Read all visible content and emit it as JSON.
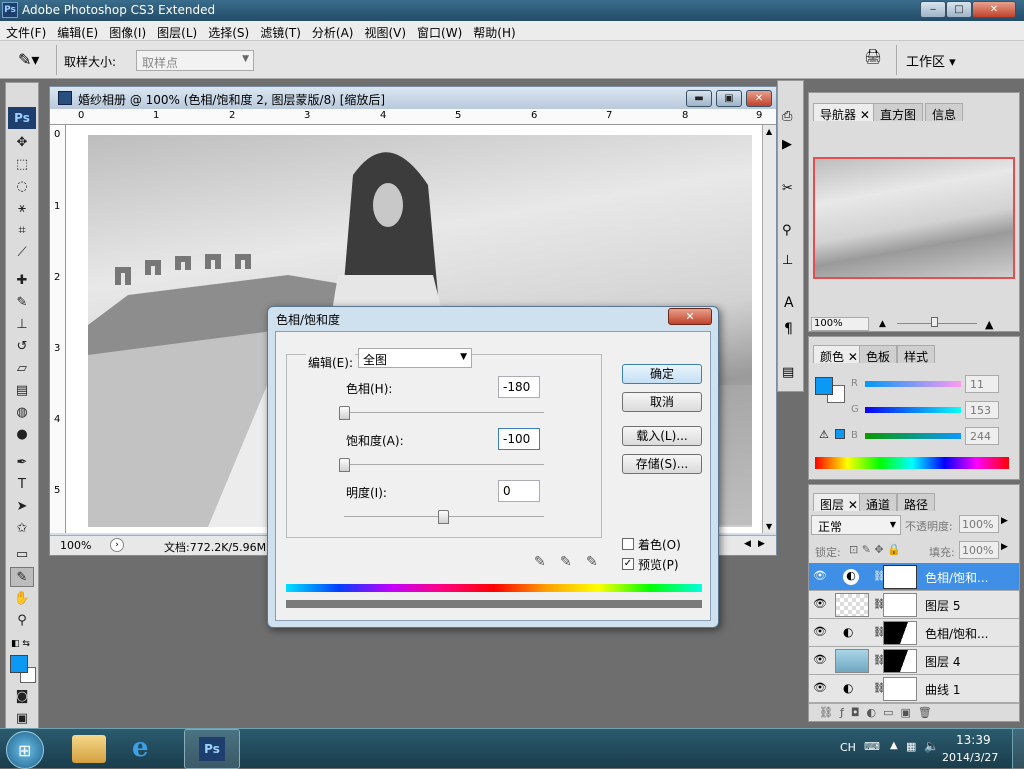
{
  "window": {
    "title": "Adobe Photoshop CS3 Extended",
    "app_icon": "Ps",
    "min": "‒",
    "max": "□",
    "close": "✕"
  },
  "menu": [
    "文件(F)",
    "编辑(E)",
    "图像(I)",
    "图层(L)",
    "选择(S)",
    "滤镜(T)",
    "分析(A)",
    "视图(V)",
    "窗口(W)",
    "帮助(H)"
  ],
  "options": {
    "sample_size_label": "取样大小:",
    "sample_size_value": "取样点",
    "workspace_label": "工作区 ▾"
  },
  "document": {
    "title": "婚纱相册 @ 100% (色相/饱和度 2, 图层蒙版/8) [缩放后]",
    "ruler_top": [
      "0",
      "1",
      "2",
      "3",
      "4",
      "5",
      "6",
      "7",
      "8",
      "9"
    ],
    "ruler_left": [
      "0",
      "1",
      "2",
      "3",
      "4",
      "5"
    ],
    "zoom": "100%",
    "doc_info": "文档:772.2K/5.96M"
  },
  "dialog": {
    "title": "色相/饱和度",
    "edit_label": "编辑(E):",
    "edit_value": "全图",
    "hue_label": "色相(H):",
    "hue_value": "-180",
    "sat_label": "饱和度(A):",
    "sat_value": "-100",
    "light_label": "明度(I):",
    "light_value": "0",
    "ok": "确定",
    "cancel": "取消",
    "load": "载入(L)...",
    "save": "存储(S)...",
    "colorize": "着色(O)",
    "preview": "预览(P)",
    "colorize_checked": false,
    "preview_checked": true
  },
  "navigator": {
    "tabs": [
      "导航器",
      "直方图",
      "信息"
    ],
    "zoom": "100%"
  },
  "color_panel": {
    "tabs": [
      "颜色",
      "色板",
      "样式"
    ],
    "r_label": "R",
    "r_value": "11",
    "g_label": "G",
    "g_value": "153",
    "b_label": "B",
    "b_value": "244",
    "foreground": "#0b99f4"
  },
  "layers_panel": {
    "tabs": [
      "图层",
      "通道",
      "路径"
    ],
    "blend_mode": "正常",
    "opacity_label": "不透明度:",
    "opacity_value": "100%",
    "lock_label": "锁定:",
    "fill_label": "填充:",
    "fill_value": "100%",
    "layers": [
      {
        "name": "色相/饱和...",
        "type": "adjustment",
        "selected": true
      },
      {
        "name": "图层 5",
        "type": "pixel",
        "selected": false
      },
      {
        "name": "色相/饱和...",
        "type": "adjustment",
        "selected": false
      },
      {
        "name": "图层 4",
        "type": "pixel",
        "selected": false
      },
      {
        "name": "曲线 1",
        "type": "adjustment",
        "selected": false
      }
    ]
  },
  "taskbar": {
    "lang": "CH",
    "time": "13:39",
    "date": "2014/3/27"
  }
}
